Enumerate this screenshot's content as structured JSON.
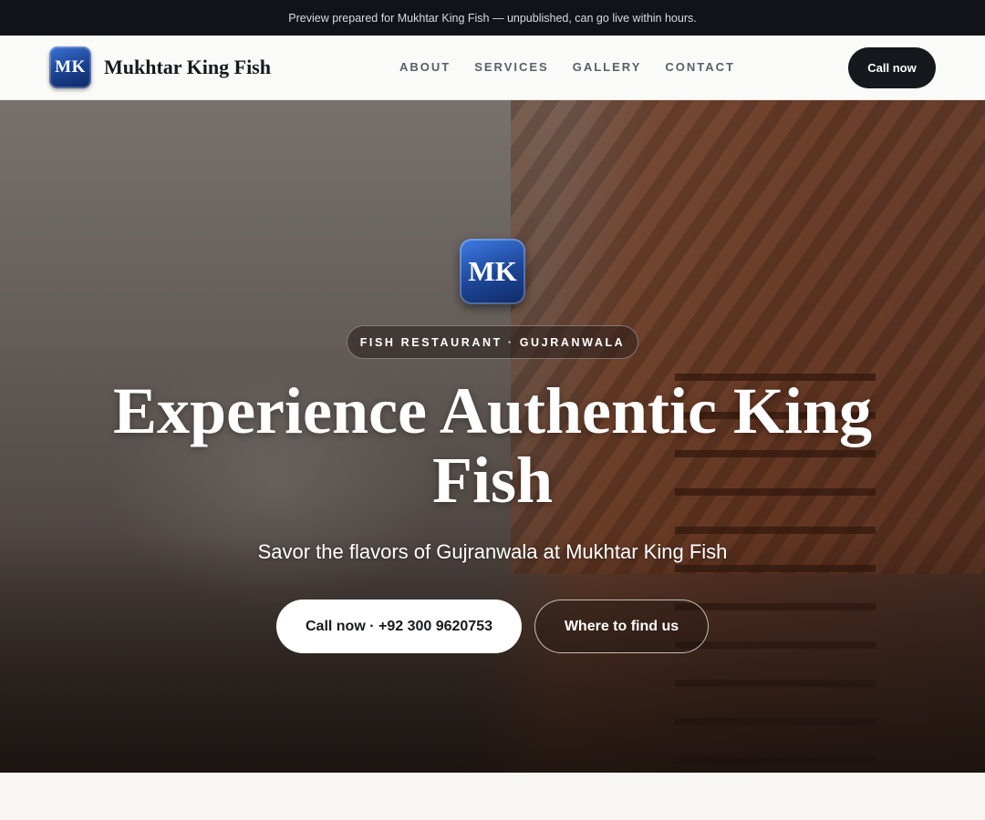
{
  "announcement": "Preview prepared for Mukhtar King Fish — unpublished, can go live within hours.",
  "header": {
    "logo_text": "MK",
    "brand_name": "Mukhtar King Fish",
    "nav": [
      "ABOUT",
      "SERVICES",
      "GALLERY",
      "CONTACT"
    ],
    "call_label": "Call now"
  },
  "hero": {
    "logo_text": "MK",
    "tagline": "FISH RESTAURANT · GUJRANWALA",
    "headline": "Experience Authentic King Fish",
    "subheadline": "Savor the flavors of Gujranwala at Mukhtar King Fish",
    "primary_cta": "Call now · +92 300 9620753",
    "secondary_cta": "Where to find us"
  },
  "colors": {
    "topbar_bg": "#121318",
    "accent_dark": "#17181d",
    "logo_blue": "#1d4596"
  }
}
